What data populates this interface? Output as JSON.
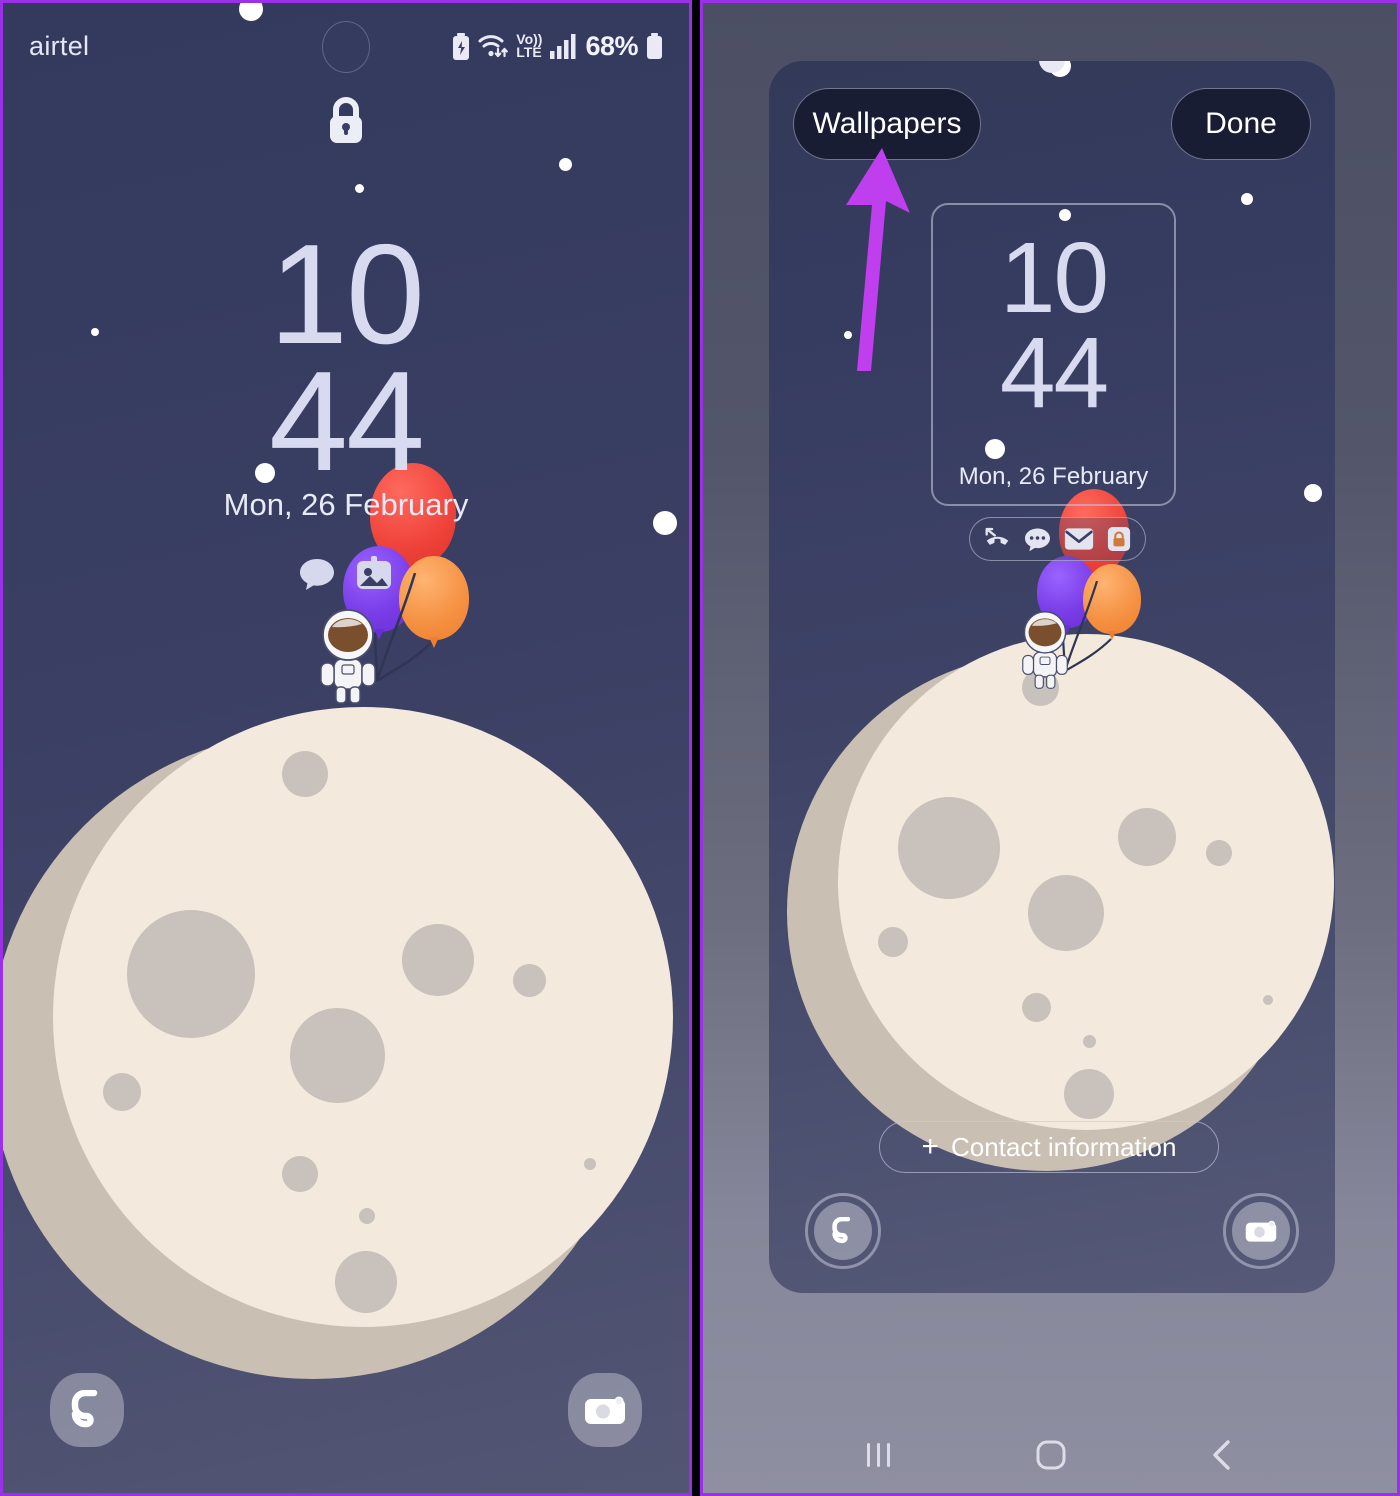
{
  "annotation": {
    "arrow_color": "#bf3fef",
    "points_to": "Wallpapers"
  },
  "theme": {
    "lock_bg_top": "#343a5e",
    "lock_bg_bottom": "#535673",
    "editor_bg_top": "#4c4f63",
    "editor_bg_bottom": "#8e8fa1",
    "panel_border": "#9b30e8",
    "clock_text": "#d8dbf0",
    "moon_body": "#f3e9dc",
    "moon_shadow": "#c9bfb3",
    "crater": "#c9c1bb",
    "balloon_red": "#f0453c",
    "balloon_purple": "#7a3ee8",
    "balloon_orange": "#f59244"
  },
  "left_panel": {
    "name": "lock-screen",
    "statusbar": {
      "carrier": "airtel",
      "battery_percent": "68%",
      "icons": [
        "battery-saver-icon",
        "wifi-icon",
        "volte-icon",
        "signal-bars-icon",
        "battery-icon"
      ],
      "volte_label_top": "Vo))",
      "volte_label_bottom": "LTE"
    },
    "lock_icon": "lock-icon",
    "clock": {
      "hours": "10",
      "minutes": "44"
    },
    "date": "Mon, 26 February",
    "notifications": [
      "chat-bubble-icon",
      "photo-icon"
    ],
    "shortcuts": {
      "left": "phone-icon",
      "right": "camera-icon"
    }
  },
  "right_panel": {
    "name": "lock-screen-editor",
    "toolbar": {
      "wallpapers_label": "Wallpapers",
      "done_label": "Done"
    },
    "clock": {
      "hours": "10",
      "minutes": "44"
    },
    "date": "Mon, 26 February",
    "notifications": [
      "missed-call-icon",
      "chat-bubble-icon",
      "mail-icon",
      "shopping-bag-icon"
    ],
    "contact_button": {
      "plus": "+",
      "label": "Contact information"
    },
    "shortcuts": {
      "left": "phone-icon",
      "right": "camera-icon"
    },
    "navbar": [
      "recents-icon",
      "home-icon",
      "back-icon"
    ]
  }
}
